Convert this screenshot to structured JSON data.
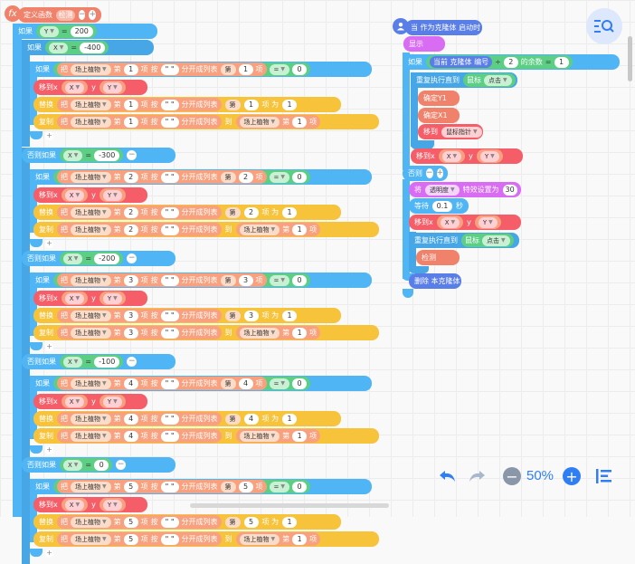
{
  "func_def": {
    "label": "定义函数",
    "name": "检测"
  },
  "if_rows": [
    {
      "top": "如果",
      "var": "Y",
      "op": "=",
      "val": "200"
    },
    {
      "top": "如果",
      "var": "X",
      "op": "=",
      "val": "-400"
    }
  ],
  "elif_label": "否则如果",
  "if_label": "如果",
  "else_label": "否则",
  "cond": {
    "get": "把",
    "list": "场上植物",
    "nth": "第",
    "item": "项",
    "split_by": "按",
    "quote": "\" \"",
    "split": "分开成列表",
    "eq": "=",
    "zero": "0"
  },
  "move": {
    "label": "移到x",
    "x": "X",
    "y_label": "y",
    "y": "Y"
  },
  "replace": {
    "label": "替换",
    "of": "把",
    "list": "场上植物",
    "nth": "第",
    "item": "项",
    "with": "项 为",
    "one": "1"
  },
  "copy": {
    "label": "复制",
    "of": "把",
    "list": "场上植物",
    "nth": "第",
    "item": "项",
    "to": "到",
    "list2": "场上植物",
    "one": "1"
  },
  "sections": [
    {
      "x_val": "-400",
      "col": "1"
    },
    {
      "x_val": "-300",
      "col": "2"
    },
    {
      "x_val": "-200",
      "col": "3"
    },
    {
      "x_val": "-100",
      "col": "4"
    },
    {
      "x_val": "0",
      "col": "5"
    }
  ],
  "clone": {
    "hat": "当 作为克隆体 启动时",
    "show": "显示",
    "if": "如果",
    "clone_idx": "当前 克隆体 编号",
    "div": "÷",
    "two": "2",
    "mod": "的余数",
    "eq": "=",
    "one": "1",
    "repeat_until": "重复执行直到",
    "mouse": "鼠标",
    "click": "点击",
    "set_y": "确定Y1",
    "set_x": "确定X1",
    "move_to": "移到",
    "mouse_ptr": "鼠标指针",
    "move": "移到x",
    "x": "X",
    "y_label": "y",
    "y": "Y",
    "else": "否则",
    "effect_label": "将",
    "effect": "透明度",
    "effect_set": "特效设置为",
    "effect_val": "30",
    "wait": "等待",
    "wait_val": "0.1",
    "sec": "秒",
    "detect": "检测",
    "delete": "删除 本克隆体"
  },
  "zoom": {
    "value": "50%"
  },
  "icons": {
    "undo": "undo-icon",
    "redo": "redo-icon",
    "zoom_out": "zoom-out-icon",
    "zoom_in": "zoom-in-icon",
    "align": "align-icon",
    "search": "search-icon"
  }
}
